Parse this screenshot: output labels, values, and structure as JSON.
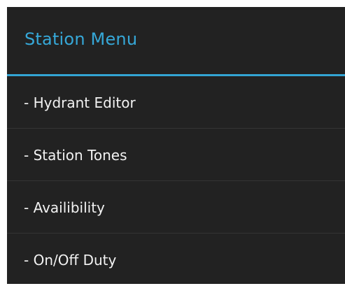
{
  "menu": {
    "title": "Station Menu",
    "items": [
      {
        "label": "- Hydrant Editor"
      },
      {
        "label": "- Station Tones"
      },
      {
        "label": "- Availibility"
      },
      {
        "label": "- On/Off Duty"
      }
    ]
  },
  "colors": {
    "background": "#222222",
    "accent": "#33a5d4",
    "text": "#f2f2f2",
    "divider": "#343434"
  }
}
